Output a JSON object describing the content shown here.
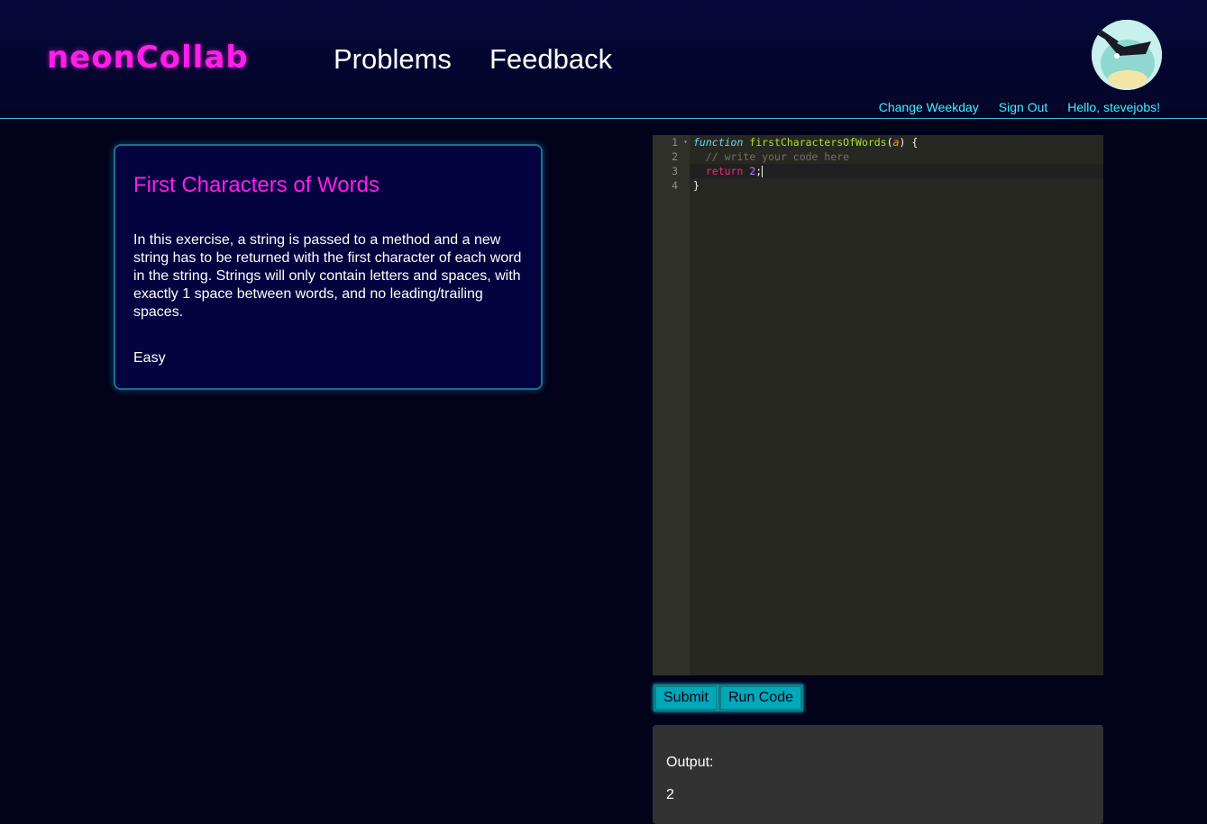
{
  "header": {
    "logo": "neonCollab",
    "nav": [
      "Problems",
      "Feedback"
    ],
    "user_links": {
      "change_weekday": "Change Weekday",
      "sign_out": "Sign Out",
      "greeting": "Hello, stevejobs!"
    }
  },
  "problem": {
    "title": "First Characters of Words",
    "description": "In this exercise, a string is passed to a method and a new string has to be returned with the first character of each word in the string. Strings will only contain letters and spaces, with exactly 1 space between words, and no leading/trailing spaces.",
    "difficulty": "Easy"
  },
  "editor": {
    "line_numbers": [
      "1",
      "2",
      "3",
      "4"
    ],
    "lines": {
      "l1_keyword": "function",
      "l1_name": "firstCharactersOfWords",
      "l1_param": "a",
      "l2_comment": "// write your code here",
      "l3_keyword": "return",
      "l3_value": "2",
      "l4": "}"
    }
  },
  "buttons": {
    "submit": "Submit",
    "run_code": "Run Code"
  },
  "output": {
    "label": "Output:",
    "value": "2"
  },
  "colors": {
    "accent_magenta": "#ff1fe9",
    "accent_cyan": "#3ff3ff",
    "button_teal": "#00a8b8",
    "background": "#02021a"
  }
}
